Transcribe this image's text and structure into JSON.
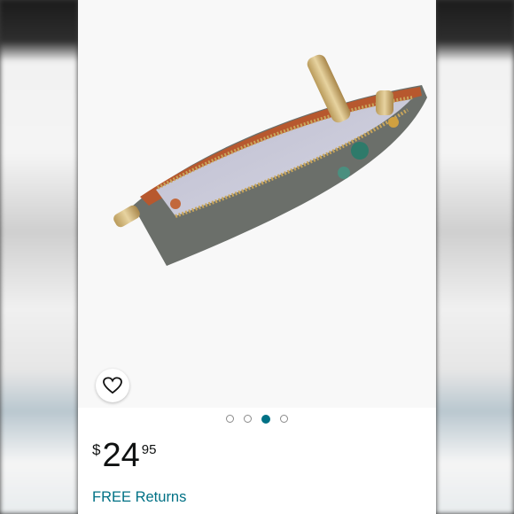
{
  "product": {
    "image_alt": "zip pouch open",
    "carousel": {
      "count": 4,
      "active_index": 2
    }
  },
  "price": {
    "symbol": "$",
    "whole": "24",
    "fraction": "95"
  },
  "returns_label": "FREE Returns",
  "icons": {
    "favorite": "heart-outline-icon"
  },
  "colors": {
    "accent": "#007185",
    "text": "#0f1111"
  }
}
